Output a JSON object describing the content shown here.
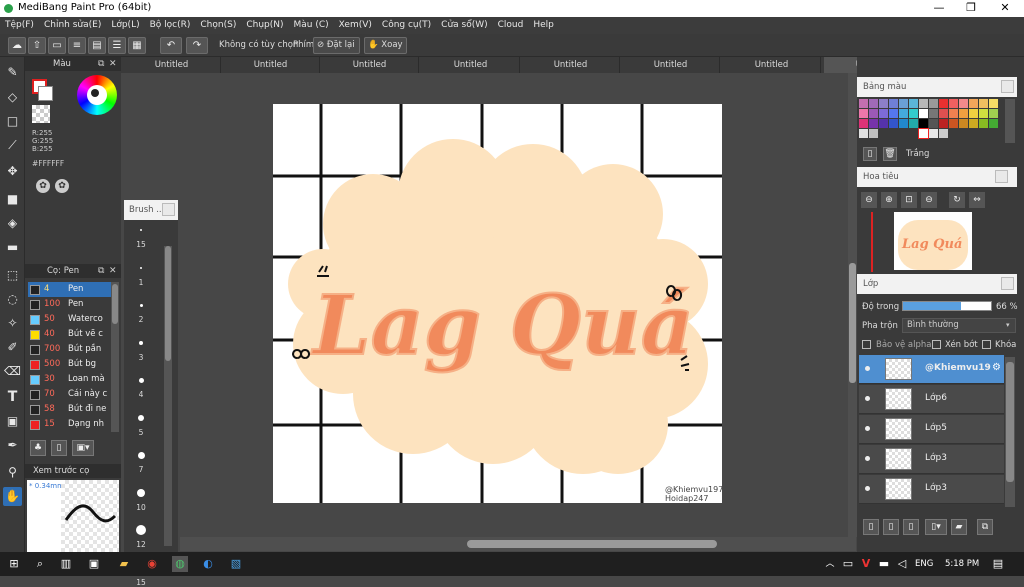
{
  "titlebar": {
    "title": "MediBang Paint Pro (64bit)",
    "minimize": "—",
    "maximize": "❐",
    "close": "✕"
  },
  "menu": [
    "Tệp(F)",
    "Chỉnh sửa(E)",
    "Lớp(L)",
    "Bộ lọc(R)",
    "Chọn(S)",
    "Chụp(N)",
    "Màu (C)",
    "Xem(V)",
    "Công cụ(T)",
    "Cửa sổ(W)",
    "Cloud",
    "Help"
  ],
  "toolbar": {
    "no_option": "Không có tùy chọn",
    "shortcut": "Phím",
    "reset": "Đặt lại",
    "rotate": "Xoay"
  },
  "tabs": [
    "Untitled",
    "Untitled",
    "Untitled",
    "Untitled",
    "Untitled",
    "Untitled",
    "Untitled",
    "Untitled"
  ],
  "color_panel": {
    "title": "Màu",
    "r": "R:255",
    "g": "G:255",
    "b": "B:255",
    "hex": "#FFFFFF",
    "colors": {
      "fg": "#ffffff",
      "fg_border": "#e02020"
    }
  },
  "brush_panel": {
    "title": "Cọ: Pen",
    "items": [
      {
        "size": "4",
        "name": "Pen",
        "color": "#222222"
      },
      {
        "size": "100",
        "name": "Pen",
        "color": "#222222"
      },
      {
        "size": "50",
        "name": "Waterco",
        "color": "#66ccff"
      },
      {
        "size": "40",
        "name": "Bút vẽ c",
        "color": "#ffdd00"
      },
      {
        "size": "700",
        "name": "Bút pần",
        "color": "#222222"
      },
      {
        "size": "500",
        "name": "Bút bg",
        "color": "#ee2222"
      },
      {
        "size": "30",
        "name": "Loan mà",
        "color": "#66ccff"
      },
      {
        "size": "70",
        "name": "Cái này c",
        "color": "#222222"
      },
      {
        "size": "58",
        "name": "Bút đi ne",
        "color": "#222222"
      },
      {
        "size": "15",
        "name": "Dạng nh",
        "color": "#ee2222"
      }
    ]
  },
  "preview_panel": {
    "title": "Xem trước cọ",
    "size": "* 0.34mm"
  },
  "brush_size_panel": {
    "title": "Brush ...",
    "sizes": [
      "15",
      "1",
      "2",
      "3",
      "4",
      "5",
      "7",
      "10",
      "12",
      "15"
    ]
  },
  "canvas": {
    "text": "Lag Quá",
    "watermark_line1": "@Khiemvu197",
    "watermark_line2": "Hoidap247"
  },
  "palette_panel": {
    "title": "Bảng màu",
    "selected_label": "Trắng"
  },
  "navigator_panel": {
    "title": "Hoa tiêu",
    "thumb_text": "Lag Quá"
  },
  "layer_panel": {
    "title": "Lớp",
    "opacity_label": "Độ trong",
    "opacity_value": "66 %",
    "opacity_fraction": 0.66,
    "blend_label": "Pha trộn",
    "blend_value": "Bình thường",
    "protect_alpha": "Bảo vệ alpha",
    "clipping": "Xén bớt",
    "lock": "Khóa",
    "layers": [
      "@Khiemvu19",
      "Lớp6",
      "Lớp5",
      "Lớp3",
      "Lớp3"
    ]
  },
  "taskbar": {
    "lang": "ENG",
    "time": "5:18 PM"
  }
}
